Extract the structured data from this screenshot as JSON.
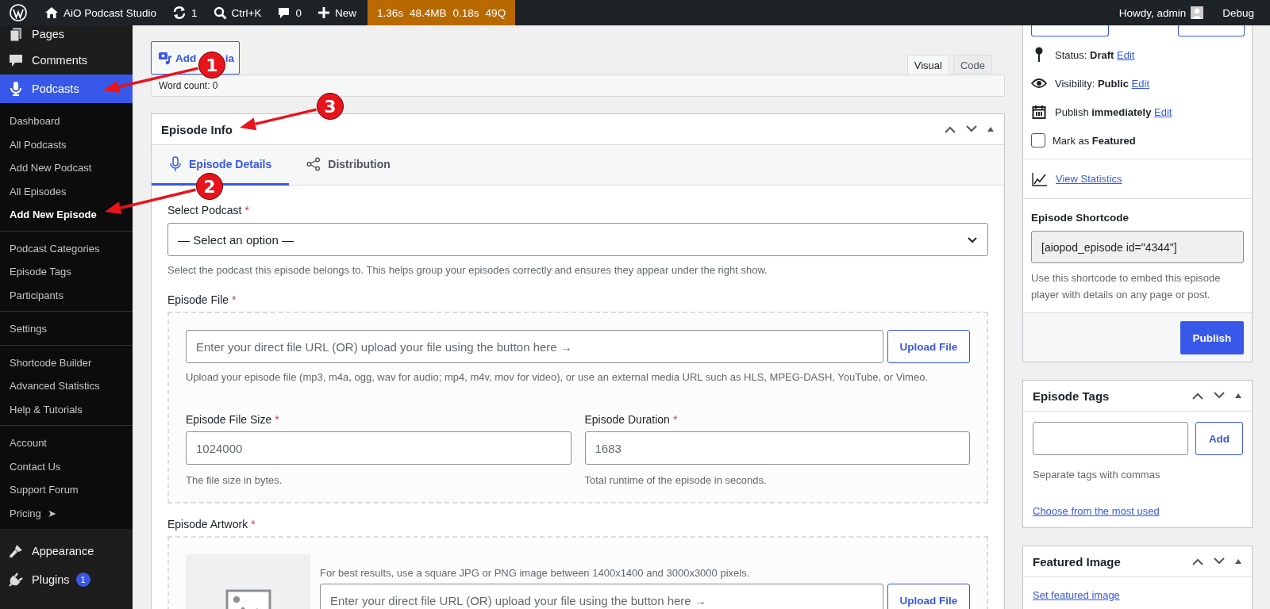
{
  "admin_bar": {
    "site": "AiO Podcast Studio",
    "updates": "1",
    "search": "Ctrl+K",
    "comments": "0",
    "new": "New",
    "debug_stats": [
      "1.36s",
      "48.4MB",
      "0.18s",
      "49Q"
    ],
    "greeting": "Howdy, admin",
    "debug": "Debug"
  },
  "sidebar": {
    "items": [
      {
        "label": "Pages",
        "selected": false
      },
      {
        "label": "Comments",
        "selected": false
      },
      {
        "label": "Podcasts",
        "selected": true,
        "submenu": [
          [
            {
              "label": "Dashboard",
              "selected": false
            },
            {
              "label": "All Podcasts",
              "selected": false
            },
            {
              "label": "Add New Podcast",
              "selected": false
            },
            {
              "label": "All Episodes",
              "selected": false
            },
            {
              "label": "Add New Episode",
              "selected": true
            }
          ],
          [
            {
              "label": "Podcast Categories",
              "selected": false
            },
            {
              "label": "Episode Tags",
              "selected": false
            },
            {
              "label": "Participants",
              "selected": false
            }
          ],
          [
            {
              "label": "Settings",
              "selected": false
            }
          ],
          [
            {
              "label": "Shortcode Builder",
              "selected": false
            },
            {
              "label": "Advanced Statistics",
              "selected": false
            },
            {
              "label": "Help & Tutorials",
              "selected": false
            }
          ],
          [
            {
              "label": "Account",
              "selected": false
            },
            {
              "label": "Contact Us",
              "selected": false
            },
            {
              "label": "Support Forum",
              "selected": false
            },
            {
              "label": "Pricing",
              "selected": false,
              "arrow": "➤"
            }
          ]
        ]
      },
      {
        "label": "Appearance",
        "selected": false
      },
      {
        "label": "Plugins",
        "selected": false,
        "badge": "1"
      }
    ]
  },
  "editor": {
    "add_media": [
      "Add",
      "ia"
    ],
    "tabs": [
      {
        "label": "Visual",
        "selected": true
      },
      {
        "label": "Code",
        "selected": false
      }
    ],
    "word_count": "Word count: 0"
  },
  "episode_info": {
    "title": "Episode Info",
    "tabs": [
      {
        "label": "Episode Details",
        "selected": true
      },
      {
        "label": "Distribution",
        "selected": false
      }
    ],
    "select_podcast": {
      "label": "Select Podcast",
      "required": "*",
      "value": "— Select an option —",
      "help": "Select the podcast this episode belongs to. This helps group your episodes correctly and ensures they appear under the right show."
    },
    "episode_file": {
      "label": "Episode File",
      "required": "*",
      "placeholder": "Enter your direct file URL (OR) upload your file using the button here →",
      "button": "Upload File",
      "help": "Upload your episode file (mp3, m4a, ogg, wav for audio; mp4, m4v, mov for video), or use an external media URL such as HLS, MPEG-DASH, YouTube, or Vimeo.",
      "fields": [
        {
          "label": "Episode File Size",
          "required": "*",
          "placeholder": "1024000",
          "help": "The file size in bytes."
        },
        {
          "label": "Episode Duration",
          "required": "*",
          "placeholder": "1683",
          "help": "Total runtime of the episode in seconds."
        }
      ]
    },
    "artwork": {
      "label": "Episode Artwork",
      "required": "*",
      "help": "For best results, use a square JPG or PNG image between 1400x1400 and 3000x3000 pixels.",
      "placeholder": "Enter your direct file URL (OR) upload your file using the button here →",
      "button": "Upload File"
    }
  },
  "publish_box": {
    "rows": [
      {
        "text": "Status: **Draft**",
        "link": "Edit"
      },
      {
        "text": "Visibility: **Public**",
        "link": "Edit"
      },
      {
        "text": "Publish **immediately**",
        "link": "Edit"
      }
    ],
    "featured": {
      "text": "Mark as **Featured**",
      "checked": false
    },
    "stats_link": "View Statistics",
    "shortcode": {
      "title": "Episode Shortcode",
      "value": "[aiopod_episode id=\"4344\"]",
      "help": "Use this shortcode to embed this episode player with details on any page or post."
    },
    "publish": "Publish"
  },
  "tags_box": {
    "title": "Episode Tags",
    "button": "Add",
    "help": "Separate tags with commas",
    "link": "Choose from the most used"
  },
  "featured_image": {
    "title": "Featured Image",
    "link": "Set featured image"
  },
  "annotations": [
    {
      "number": "1"
    },
    {
      "number": "2"
    },
    {
      "number": "3"
    }
  ]
}
